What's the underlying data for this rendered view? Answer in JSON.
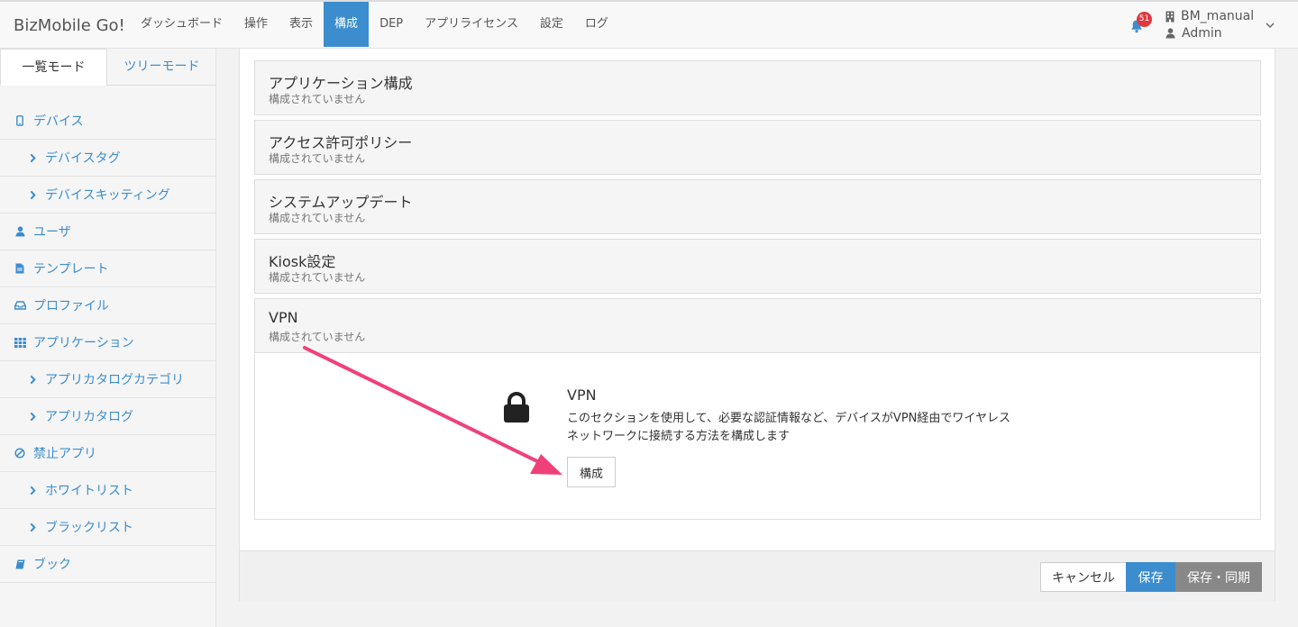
{
  "app": {
    "brand": "BizMobile Go!"
  },
  "nav": {
    "items": [
      {
        "label": "ダッシュボード",
        "active": false
      },
      {
        "label": "操作",
        "active": false
      },
      {
        "label": "表示",
        "active": false
      },
      {
        "label": "構成",
        "active": true
      },
      {
        "label": "DEP",
        "active": false
      },
      {
        "label": "アプリライセンス",
        "active": false
      },
      {
        "label": "設定",
        "active": false
      },
      {
        "label": "ログ",
        "active": false
      }
    ],
    "notification_count": "51",
    "user_org": "BM_manual",
    "user_name": "Admin"
  },
  "sidebar": {
    "tabs": [
      "一覧モード",
      "ツリーモード"
    ],
    "items": [
      {
        "label": "デバイス",
        "icon": "mobile-icon",
        "level": 0
      },
      {
        "label": "デバイスタグ",
        "icon": "chevron-right-icon",
        "level": 1
      },
      {
        "label": "デバイスキッティング",
        "icon": "chevron-right-icon",
        "level": 1
      },
      {
        "label": "ユーザ",
        "icon": "user-icon",
        "level": 0
      },
      {
        "label": "テンプレート",
        "icon": "document-icon",
        "level": 0
      },
      {
        "label": "プロファイル",
        "icon": "inbox-icon",
        "level": 0
      },
      {
        "label": "アプリケーション",
        "icon": "grid-icon",
        "level": 0
      },
      {
        "label": "アプリカタログカテゴリ",
        "icon": "chevron-right-icon",
        "level": 1
      },
      {
        "label": "アプリカタログ",
        "icon": "chevron-right-icon",
        "level": 1
      },
      {
        "label": "禁止アプリ",
        "icon": "ban-icon",
        "level": 0
      },
      {
        "label": "ホワイトリスト",
        "icon": "chevron-right-icon",
        "level": 1
      },
      {
        "label": "ブラックリスト",
        "icon": "chevron-right-icon",
        "level": 1
      },
      {
        "label": "ブック",
        "icon": "book-icon",
        "level": 0
      }
    ]
  },
  "sections": [
    {
      "title": "アプリケーション構成",
      "status": "構成されていません"
    },
    {
      "title": "アクセス許可ポリシー",
      "status": "構成されていません"
    },
    {
      "title": "システムアップデート",
      "status": "構成されていません"
    },
    {
      "title": "Kiosk設定",
      "status": "構成されていません"
    },
    {
      "title": "VPN",
      "status": "構成されていません"
    }
  ],
  "vpn_panel": {
    "icon": "lock-icon",
    "title": "VPN",
    "description_line1": "このセクションを使用して、必要な認証情報など、デバイスがVPN経由でワイヤレス",
    "description_line2": "ネットワークに接続する方法を構成します",
    "configure_label": "構成"
  },
  "footer": {
    "cancel_label": "キャンセル",
    "save_label": "保存",
    "save_sync_label": "保存・同期"
  },
  "colors": {
    "accent": "#3c8dce",
    "badge": "#e0383d",
    "arrow": "#f0407a"
  }
}
